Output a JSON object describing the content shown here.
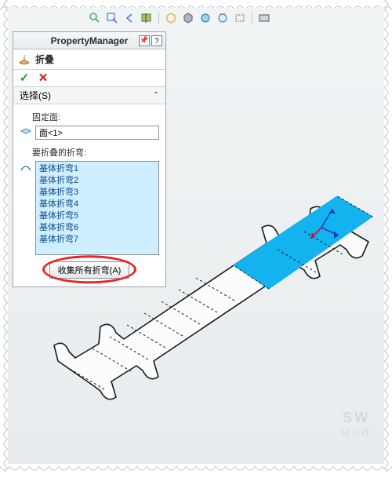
{
  "panel": {
    "title": "PropertyManager",
    "feature_name": "折叠",
    "section_title": "选择(S)",
    "fixed_face_label": "固定面:",
    "fixed_face_value": "面<1>",
    "bends_label": "要折叠的折弯:",
    "bend_items": [
      "基体折弯1",
      "基体折弯2",
      "基体折弯3",
      "基体折弯4",
      "基体折弯5",
      "基体折弯6",
      "基体折弯7"
    ],
    "collect_button": "收集所有折弯(A)"
  },
  "watermark": {
    "line1": "SW",
    "line2": "研习社"
  }
}
